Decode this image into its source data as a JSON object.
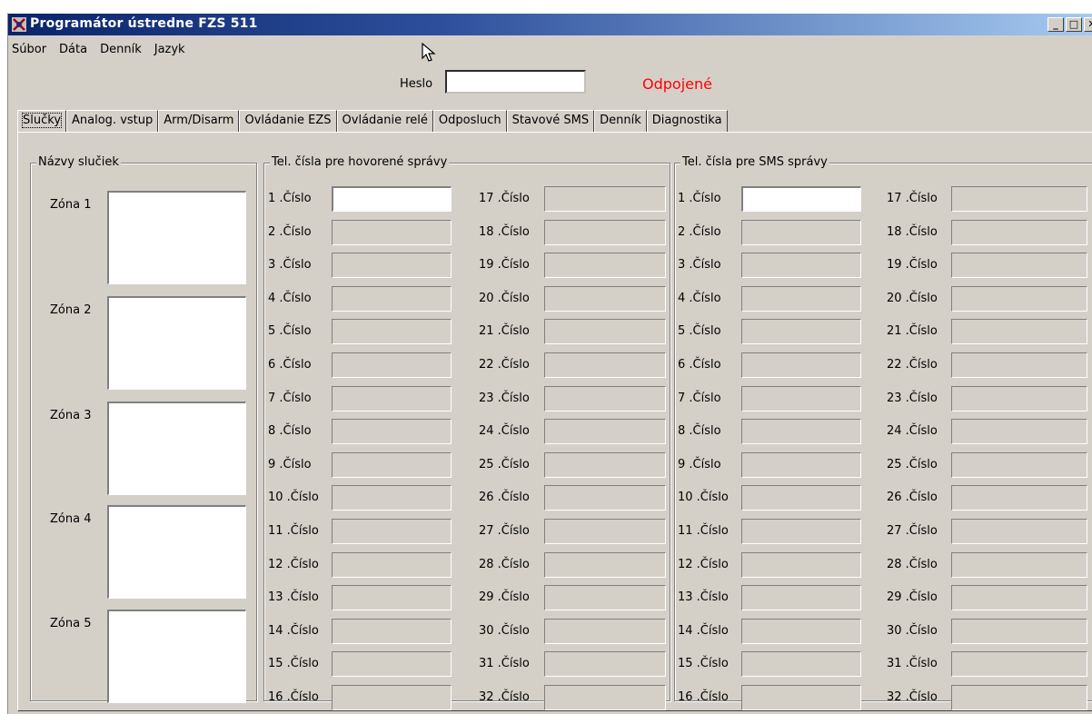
{
  "window": {
    "title": "Programátor ústredne FZS 511",
    "controls": [
      "minimize-icon",
      "maximize-icon",
      "close-icon"
    ]
  },
  "menu": [
    "Súbor",
    "Dáta",
    "Denník",
    "Jazyk"
  ],
  "password": {
    "label": "Heslo",
    "value": ""
  },
  "status": {
    "text": "Odpojené",
    "color": "#ff0000"
  },
  "tabs": [
    "Slučky",
    "Analog. vstup",
    "Arm/Disarm",
    "Ovládanie EZS",
    "Ovládanie relé",
    "Odposluch",
    "Stavové SMS",
    "Denník",
    "Diagnostika"
  ],
  "active_tab": "Slučky",
  "zones_group": {
    "title": "Názvy slučiek",
    "zones": [
      "Zóna 1",
      "Zóna 2",
      "Zóna 3",
      "Zóna 4",
      "Zóna 5"
    ]
  },
  "voice_group": {
    "title": "Tel. čísla pre hovorené správy",
    "labels": [
      "1 .Číslo",
      "2 .Číslo",
      "3 .Číslo",
      "4 .Číslo",
      "5 .Číslo",
      "6 .Číslo",
      "7 .Číslo",
      "8 .Číslo",
      "9 .Číslo",
      "10 .Číslo",
      "11 .Číslo",
      "12 .Číslo",
      "13 .Číslo",
      "14 .Číslo",
      "15 .Číslo",
      "16 .Číslo",
      "17 .Číslo",
      "18 .Číslo",
      "19 .Číslo",
      "20 .Číslo",
      "21 .Číslo",
      "22 .Číslo",
      "23 .Číslo",
      "24 .Číslo",
      "25 .Číslo",
      "26 .Číslo",
      "27 .Číslo",
      "28 .Číslo",
      "29 .Číslo",
      "30 .Číslo",
      "31 .Číslo",
      "32 .Číslo"
    ]
  },
  "sms_group": {
    "title": "Tel. čísla pre SMS správy",
    "labels": [
      "1 .Číslo",
      "2 .Číslo",
      "3 .Číslo",
      "4 .Číslo",
      "5 .Číslo",
      "6 .Číslo",
      "7 .Číslo",
      "8 .Číslo",
      "9 .Číslo",
      "10 .Číslo",
      "11 .Číslo",
      "12 .Číslo",
      "13 .Číslo",
      "14 .Číslo",
      "15 .Číslo",
      "16 .Číslo",
      "17 .Číslo",
      "18 .Číslo",
      "19 .Číslo",
      "20 .Číslo",
      "21 .Číslo",
      "22 .Číslo",
      "23 .Číslo",
      "24 .Číslo",
      "25 .Číslo",
      "26 .Číslo",
      "27 .Číslo",
      "28 .Číslo",
      "29 .Číslo",
      "30 .Číslo",
      "31 .Číslo",
      "32 .Číslo"
    ]
  }
}
